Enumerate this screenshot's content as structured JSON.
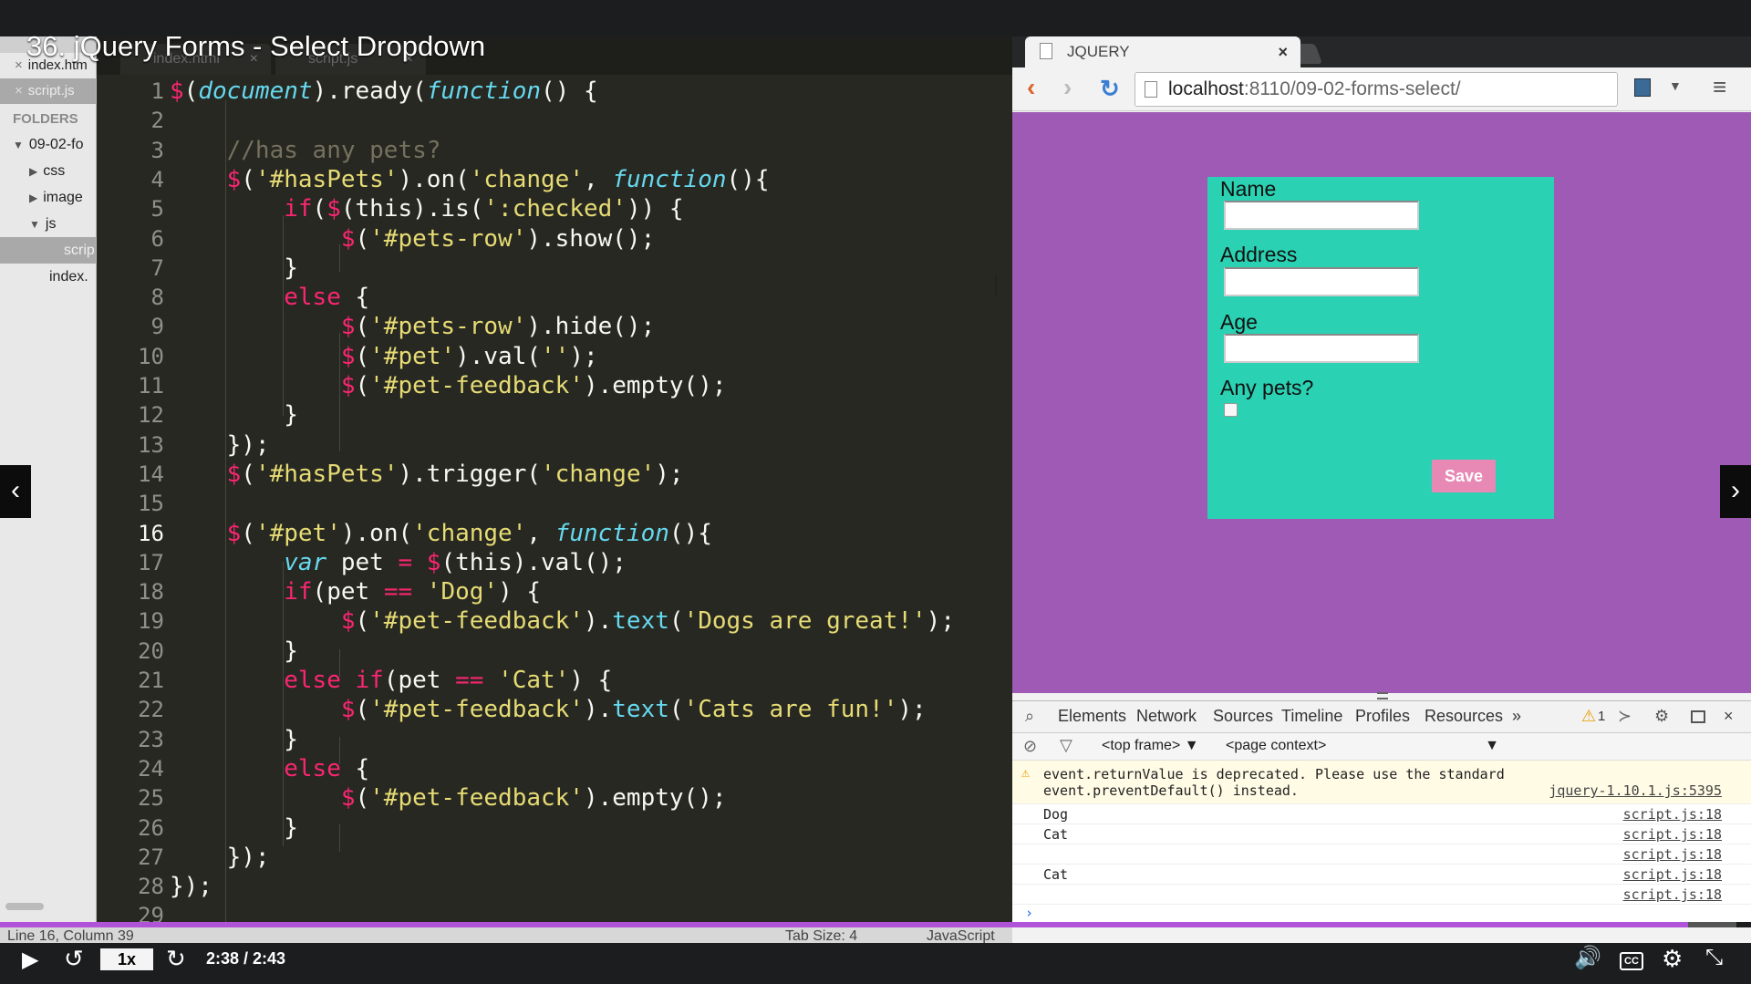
{
  "video": {
    "title": "36. jQuery Forms - Select Dropdown",
    "speed": "1x",
    "time": "2:38 / 2:43",
    "progress": 0.972
  },
  "editor": {
    "tabs": [
      "index.html",
      "script.js"
    ],
    "open_files": [
      "index.htm",
      "script.js"
    ],
    "folders_header": "FOLDERS",
    "tree": [
      "09-02-fo",
      "css",
      "image",
      "js",
      "scrip",
      "index."
    ],
    "line_numbers": [
      "1",
      "2",
      "3",
      "4",
      "5",
      "6",
      "7",
      "8",
      "9",
      "10",
      "11",
      "12",
      "13",
      "14",
      "15",
      "16",
      "17",
      "18",
      "19",
      "20",
      "21",
      "22",
      "23",
      "24",
      "25",
      "26",
      "27",
      "28",
      "29"
    ],
    "status": {
      "position": "Line 16, Column 39",
      "tab_size": "Tab Size: 4",
      "syntax": "JavaScript"
    }
  },
  "browser": {
    "tab_title": "JQUERY",
    "url_host": "localhost",
    "url_path": ":8110/09-02-forms-select/",
    "form": {
      "name_label": "Name",
      "address_label": "Address",
      "age_label": "Age",
      "pets_label": "Any pets?",
      "save_label": "Save"
    },
    "devtools_tabs": [
      "Elements",
      "Network",
      "Sources",
      "Timeline",
      "Profiles",
      "Resources",
      "»"
    ],
    "warning_count": "1",
    "frame_select": "<top frame>",
    "context_select": "<page context>",
    "console": [
      {
        "msg": "event.returnValue is deprecated. Please use the standard",
        "msg2": "event.preventDefault() instead.",
        "src": "jquery-1.10.1.js:5395"
      },
      {
        "msg": "Dog",
        "src": "script.js:18"
      },
      {
        "msg": "Cat",
        "src": "script.js:18"
      },
      {
        "msg": "",
        "src": "script.js:18"
      },
      {
        "msg": "Cat",
        "src": "script.js:18"
      },
      {
        "msg": "",
        "src": "script.js:18"
      }
    ],
    "prompt": "›"
  },
  "colors": {
    "accent": "#b153d9",
    "page_bg": "#9e5ab5",
    "form_bg": "#2bd1b3",
    "save_btn": "#e889b5"
  }
}
